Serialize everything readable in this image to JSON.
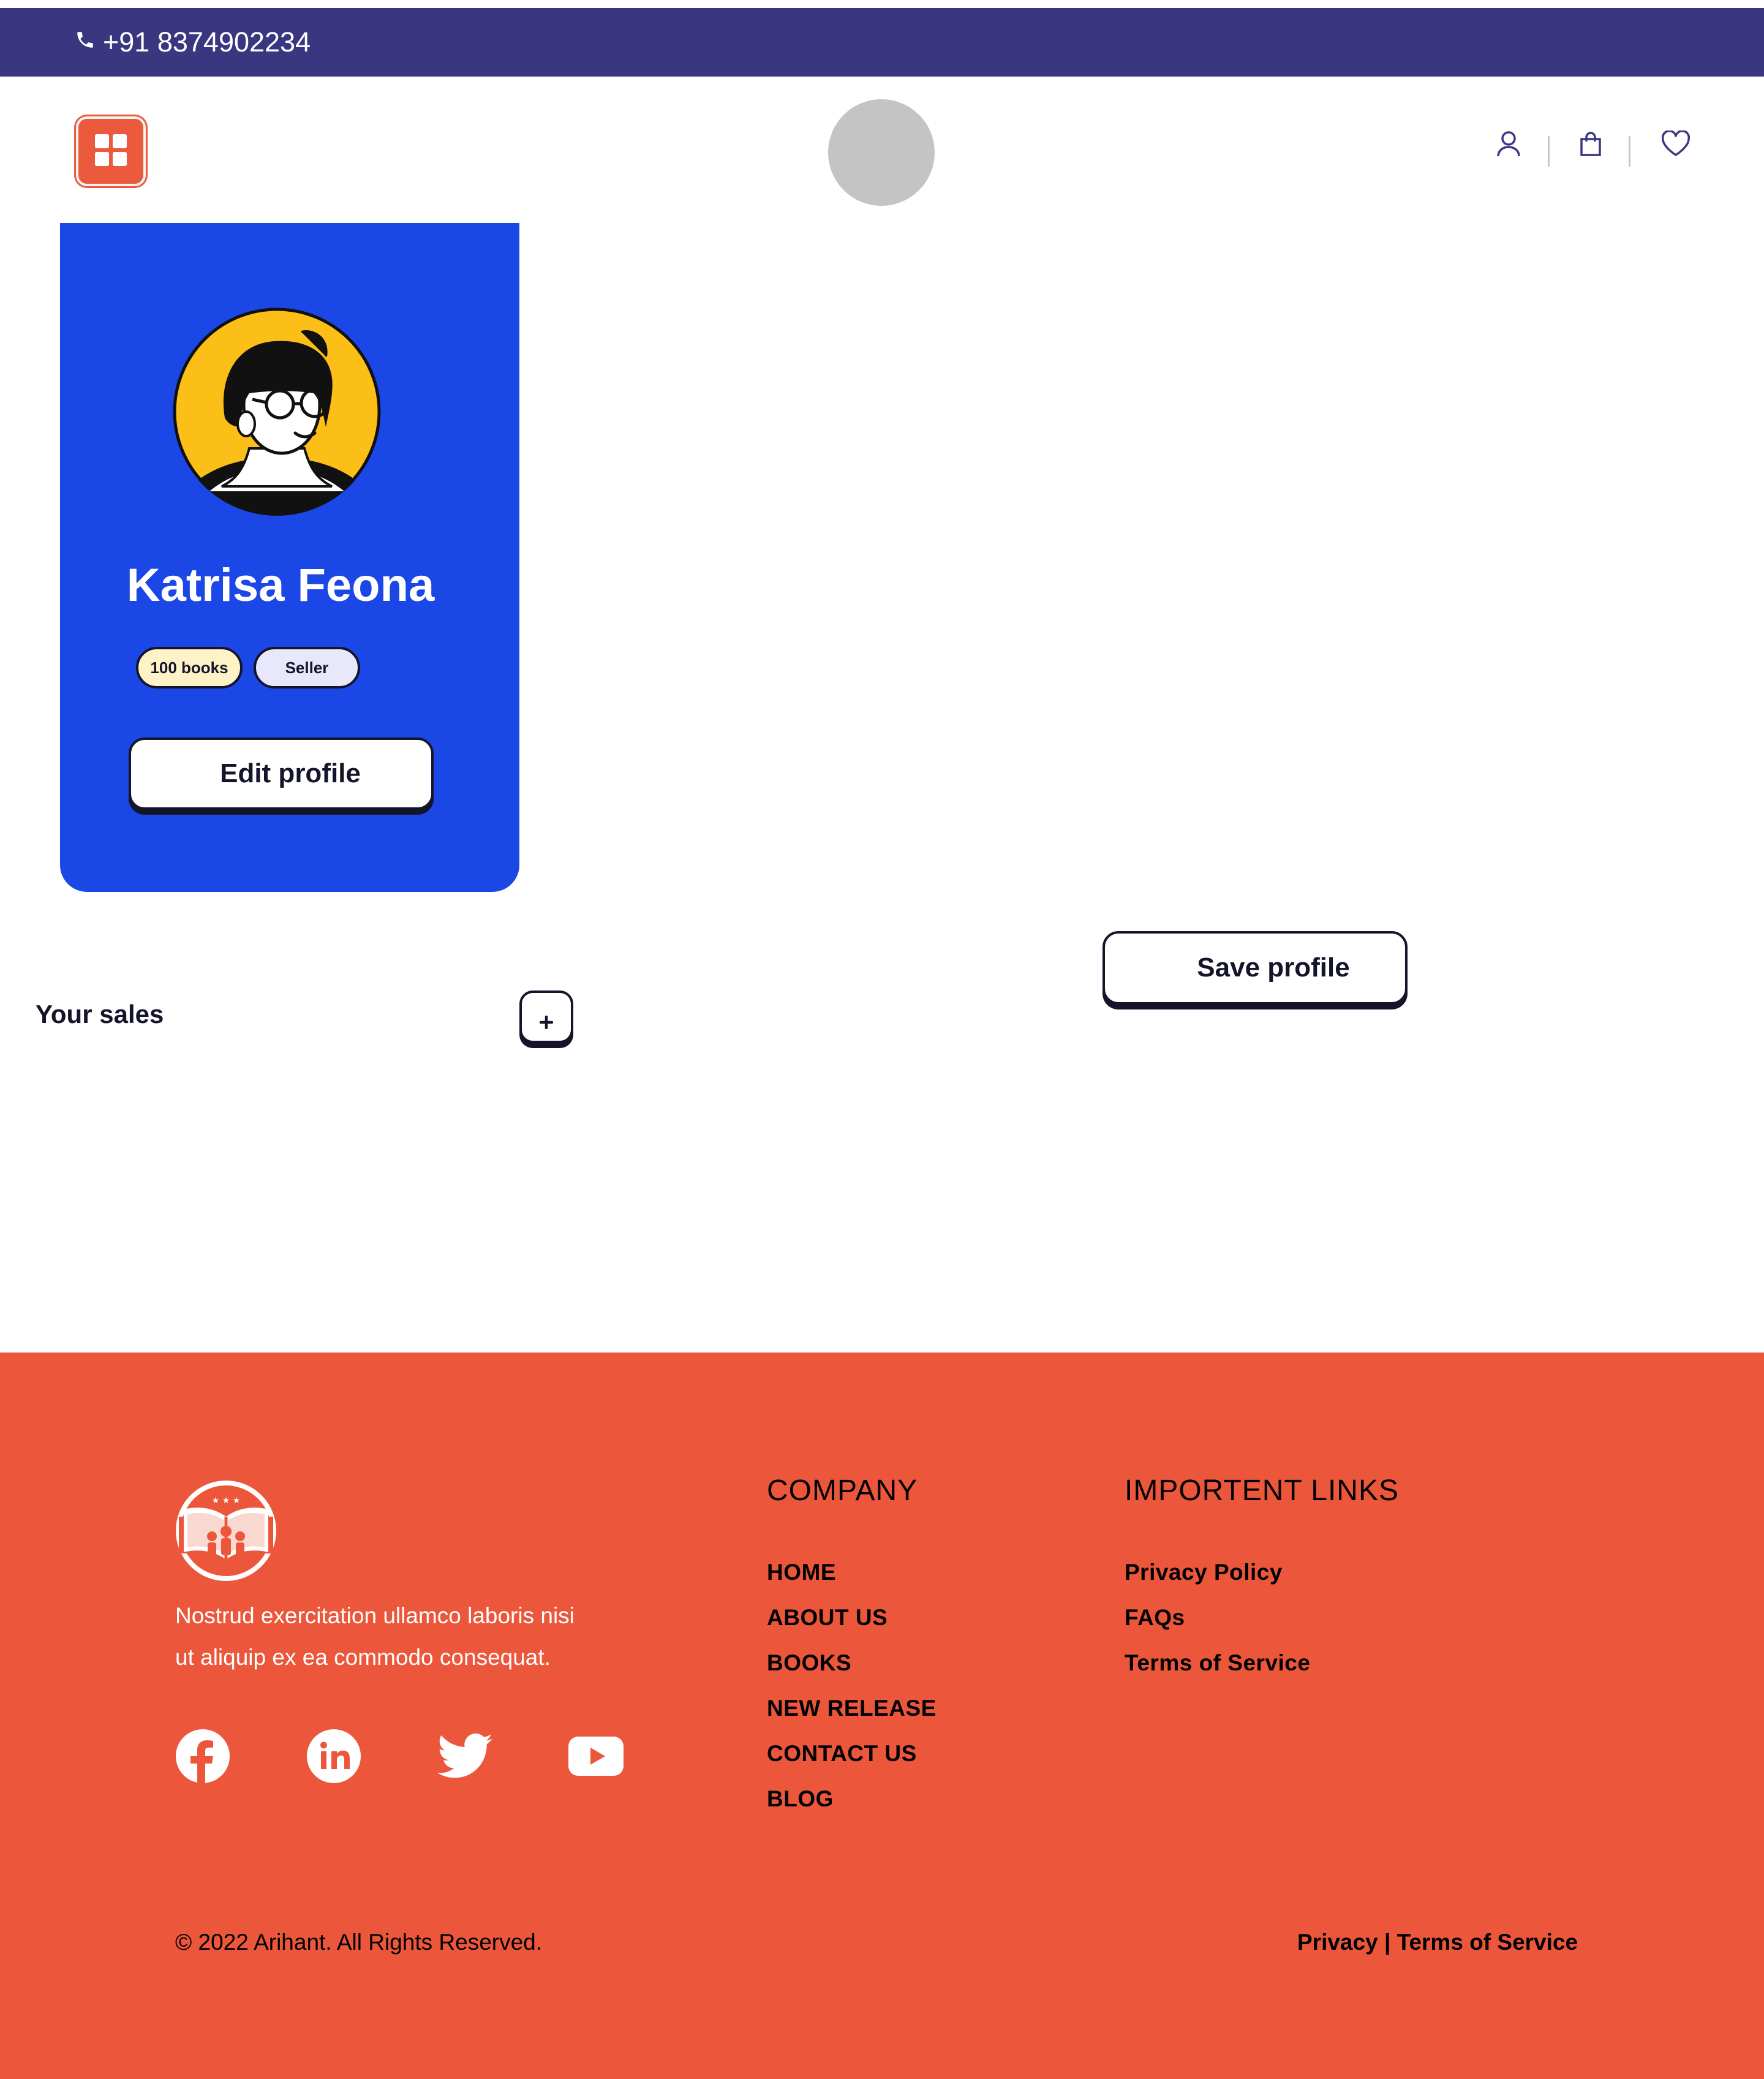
{
  "topbar": {
    "phone": "+91 8374902234",
    "phone_icon": "phone-icon",
    "background": "#3b3680"
  },
  "header": {
    "menu_icon": "grid-icon",
    "menu_color": "#ec5a3d",
    "icons": [
      "user-icon",
      "shopping-bag-icon",
      "heart-icon"
    ]
  },
  "profile": {
    "name": "Katrisa Feona",
    "badges": [
      {
        "label": "100 books",
        "color": "#fef3c7"
      },
      {
        "label": "Seller",
        "color": "#e8e7fb"
      }
    ],
    "edit_label": "Edit profile",
    "card_color": "#1a47e6"
  },
  "actions": {
    "save_label": "Save profile"
  },
  "sales": {
    "title": "Your sales",
    "add_icon": "plus-icon"
  },
  "footer": {
    "background": "#ec563b",
    "description_line1": "Nostrud exercitation ullamco laboris nisi",
    "description_line2": "ut aliquip ex ea commodo consequat.",
    "social": [
      "facebook-icon",
      "linkedin-icon",
      "twitter-icon",
      "youtube-icon"
    ],
    "company": {
      "heading": "COMPANY",
      "links": [
        "HOME",
        "ABOUT US",
        "BOOKS",
        "NEW RELEASE",
        "CONTACT US",
        "BLOG"
      ]
    },
    "important": {
      "heading": "IMPORTENT LINKS",
      "links": [
        "Privacy Policy",
        "FAQs",
        "Terms of Service"
      ]
    },
    "copyright": "© 2022 Arihant. All Rights Reserved.",
    "legal_privacy": "Privacy",
    "legal_separator": "|",
    "legal_terms": "Terms of Service"
  }
}
